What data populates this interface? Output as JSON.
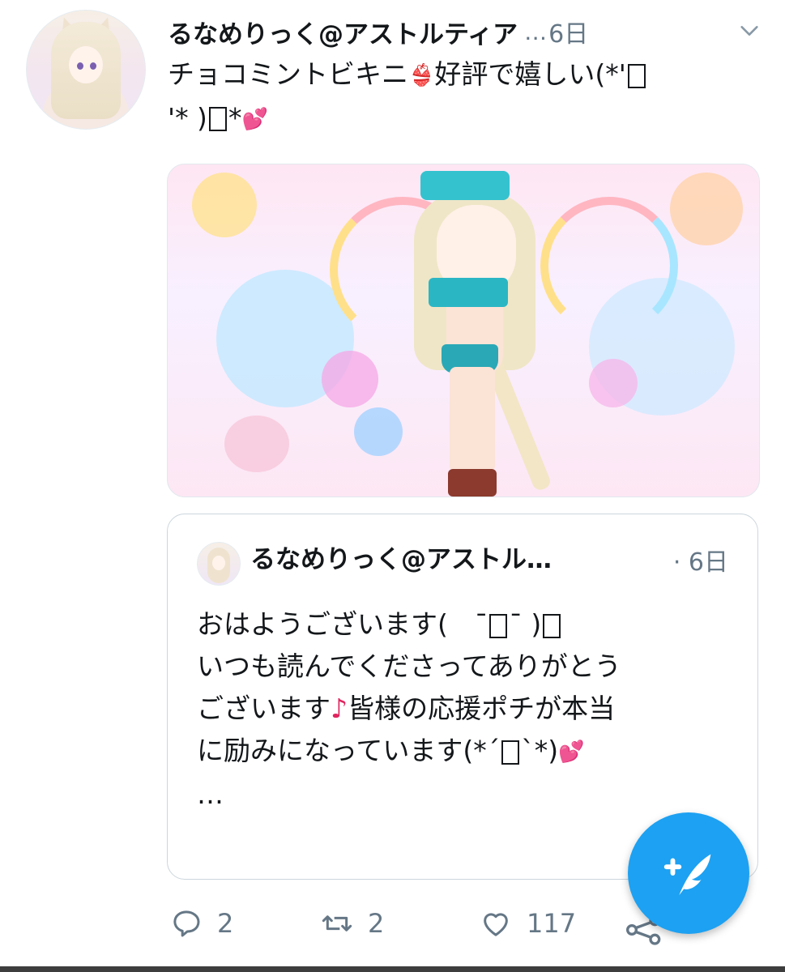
{
  "tweet": {
    "author_name": "るなめりっく@アストルティア",
    "name_truncation": "…",
    "time": "6日",
    "text_line1": "チョコミントビキニ",
    "text_line1b": "好評で嬉しい(*'",
    "text_line2a": "'* )",
    "text_line2b": "*",
    "bikini_emoji": "👙",
    "heart_emoji": "💕"
  },
  "quote": {
    "author_name": "るなめりっく@アストル…",
    "time": "· 6日",
    "line1a": "おはようございます(　¯",
    "line1b": "¯ )",
    "line2": "いつも読んでくださってありがとう",
    "line3a": "ございます",
    "note": "♪",
    "line3b": "皆様の応援ポチが本当",
    "line4a": "に励みになっています(*´",
    "line4b": "`*)",
    "heart_emoji": "💕",
    "ellipsis": "…"
  },
  "actions": {
    "reply_count": "2",
    "retweet_count": "2",
    "like_count": "117"
  },
  "colors": {
    "accent": "#1da1f2",
    "muted": "#657786",
    "heart": "#e0245e"
  },
  "icons": [
    "chevron-down-icon",
    "reply-icon",
    "retweet-icon",
    "like-icon",
    "share-icon",
    "compose-tweet-icon"
  ]
}
